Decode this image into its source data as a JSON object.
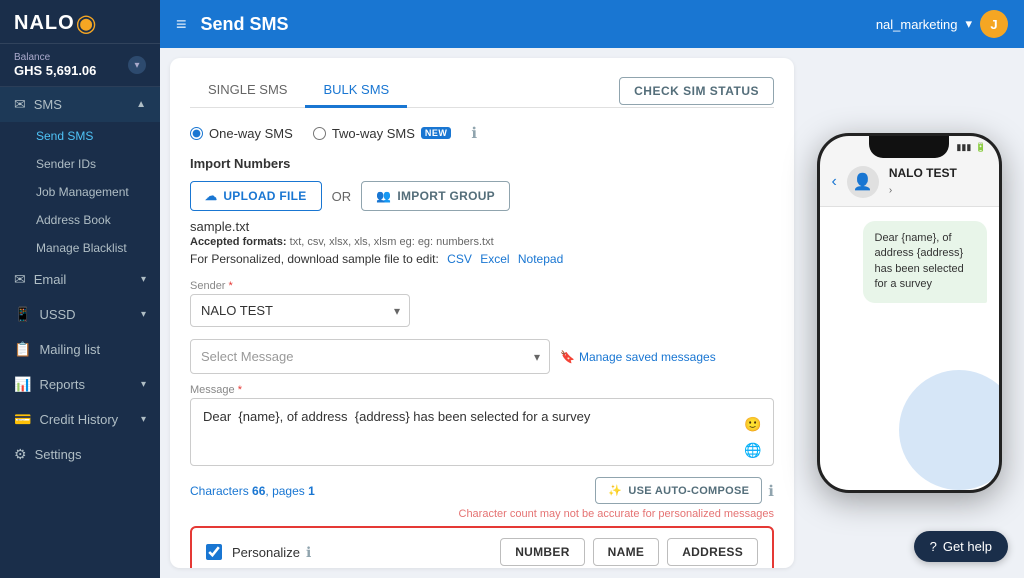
{
  "app": {
    "logo": "NALO",
    "logo_dot": "◉",
    "page_title": "Send SMS"
  },
  "sidebar": {
    "balance_label": "Balance",
    "balance_currency": "GHS",
    "balance_amount": "GHS 5,691.06",
    "nav": [
      {
        "id": "sms",
        "icon": "✉",
        "label": "SMS",
        "expanded": true,
        "active": true
      },
      {
        "id": "email",
        "icon": "📧",
        "label": "Email",
        "expanded": false
      },
      {
        "id": "ussd",
        "icon": "📱",
        "label": "USSD",
        "expanded": false
      },
      {
        "id": "mailing",
        "icon": "📋",
        "label": "Mailing list",
        "expanded": false
      },
      {
        "id": "reports",
        "icon": "📊",
        "label": "Reports",
        "expanded": false
      },
      {
        "id": "credit",
        "icon": "💳",
        "label": "Credit History",
        "expanded": false
      },
      {
        "id": "settings",
        "icon": "⚙",
        "label": "Settings"
      }
    ],
    "sms_submenu": [
      {
        "id": "send-sms",
        "label": "Send SMS",
        "active": true
      },
      {
        "id": "sender-ids",
        "label": "Sender IDs"
      },
      {
        "id": "job-management",
        "label": "Job Management"
      },
      {
        "id": "address-book",
        "label": "Address Book"
      },
      {
        "id": "manage-blacklist",
        "label": "Manage Blacklist"
      }
    ]
  },
  "topbar": {
    "title": "Send SMS",
    "user": "nal_marketing",
    "user_initial": "J",
    "menu_icon": "≡"
  },
  "tabs": [
    {
      "id": "single-sms",
      "label": "SINGLE SMS",
      "active": false
    },
    {
      "id": "bulk-sms",
      "label": "BULK SMS",
      "active": true
    }
  ],
  "check_sim": {
    "label": "CHECK SIM STATUS"
  },
  "radio_options": [
    {
      "id": "one-way",
      "label": "One-way SMS",
      "checked": true
    },
    {
      "id": "two-way",
      "label": "Two-way SMS",
      "checked": false
    }
  ],
  "two_way_badge": "NEW",
  "import": {
    "section_title": "Import Numbers",
    "upload_btn": "UPLOAD FILE",
    "or_text": "OR",
    "import_group_btn": "IMPORT GROUP",
    "filename": "sample.txt",
    "accepted_label": "Accepted formats:",
    "accepted_formats": "txt, csv, xlsx, xls, xlsm",
    "accepted_eg": "eg: numbers.txt",
    "personalized_text": "For Personalized, download sample file to edit:",
    "csv_link": "CSV",
    "excel_link": "Excel",
    "notepad_link": "Notepad"
  },
  "sender": {
    "label": "Sender",
    "required": "*",
    "value": "NALO TEST",
    "options": [
      "NALO TEST"
    ]
  },
  "message_select": {
    "placeholder": "Select Message",
    "manage_link": "Manage saved messages"
  },
  "message": {
    "label": "Message",
    "required": "*",
    "value": "Dear  {name}, of address  {address} has been selected for a survey",
    "char_count_label": "Characters",
    "char_count": "66",
    "pages_label": "pages",
    "pages": "1",
    "warning": "Character count may not be accurate for personalized messages"
  },
  "auto_compose": {
    "label": "USE AUTO-COMPOSE"
  },
  "personalize": {
    "label": "Personalize",
    "number_btn": "NUMBER",
    "name_btn": "NAME",
    "address_btn": "ADDRESS"
  },
  "phone_preview": {
    "contact_name": "NALO TEST",
    "contact_arrow": "›",
    "message": "Dear  {name}, of address  {address} has been selected for a survey",
    "status_icons": "●●● 🔋"
  },
  "get_help": {
    "label": "Get help",
    "icon": "?"
  }
}
